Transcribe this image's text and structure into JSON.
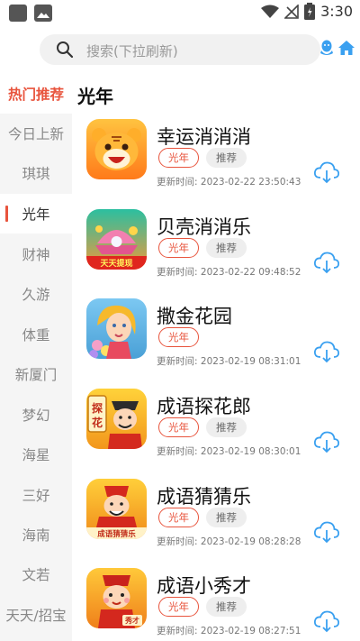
{
  "status_bar": {
    "time": "3:30",
    "icons": [
      "notification-square-icon",
      "photo-icon",
      "wifi-icon",
      "no-signal-icon",
      "battery-icon"
    ]
  },
  "header": {
    "search_placeholder": "搜索(下拉刷新)",
    "icons": [
      "search-icon",
      "qq-icon",
      "home-icon"
    ]
  },
  "colors": {
    "accent": "#e8543d",
    "blue": "#3aa0f0",
    "sidebar_bg": "#f5f5f5"
  },
  "sidebar": {
    "items": [
      {
        "label": "热门推荐",
        "state": "hot"
      },
      {
        "label": "今日上新",
        "state": ""
      },
      {
        "label": "琪琪",
        "state": ""
      },
      {
        "label": "光年",
        "state": "active"
      },
      {
        "label": "财神",
        "state": ""
      },
      {
        "label": "久游",
        "state": ""
      },
      {
        "label": "体重",
        "state": ""
      },
      {
        "label": "新厦门",
        "state": ""
      },
      {
        "label": "梦幻",
        "state": ""
      },
      {
        "label": "海星",
        "state": ""
      },
      {
        "label": "三好",
        "state": ""
      },
      {
        "label": "海南",
        "state": ""
      },
      {
        "label": "文若",
        "state": ""
      },
      {
        "label": "天天/招宝",
        "state": ""
      }
    ]
  },
  "main": {
    "section_title": "光年",
    "update_label": "更新时间:",
    "apps": [
      {
        "name": "幸运消消消",
        "tags": [
          "光年",
          "推荐"
        ],
        "updated": "2023-02-22 23:50:43",
        "icon": "tiger-game-icon"
      },
      {
        "name": "贝壳消消乐",
        "tags": [
          "光年",
          "推荐"
        ],
        "updated": "2023-02-22 09:48:52",
        "icon": "shell-game-icon",
        "icon_caption": "天天提现"
      },
      {
        "name": "撒金花园",
        "tags": [
          "光年"
        ],
        "updated": "2023-02-19 08:31:01",
        "icon": "garden-girl-icon"
      },
      {
        "name": "成语探花郎",
        "tags": [
          "光年",
          "推荐"
        ],
        "updated": "2023-02-19 08:30:01",
        "icon": "scholar-icon",
        "icon_caption": "探花"
      },
      {
        "name": "成语猜猜乐",
        "tags": [
          "光年",
          "推荐"
        ],
        "updated": "2023-02-19 08:28:28",
        "icon": "fortune-god-icon",
        "icon_caption": "成语猜猜乐"
      },
      {
        "name": "成语小秀才",
        "tags": [
          "光年",
          "推荐"
        ],
        "updated": "2023-02-19 08:27:51",
        "icon": "little-scholar-icon",
        "icon_caption": "秀才"
      }
    ]
  }
}
